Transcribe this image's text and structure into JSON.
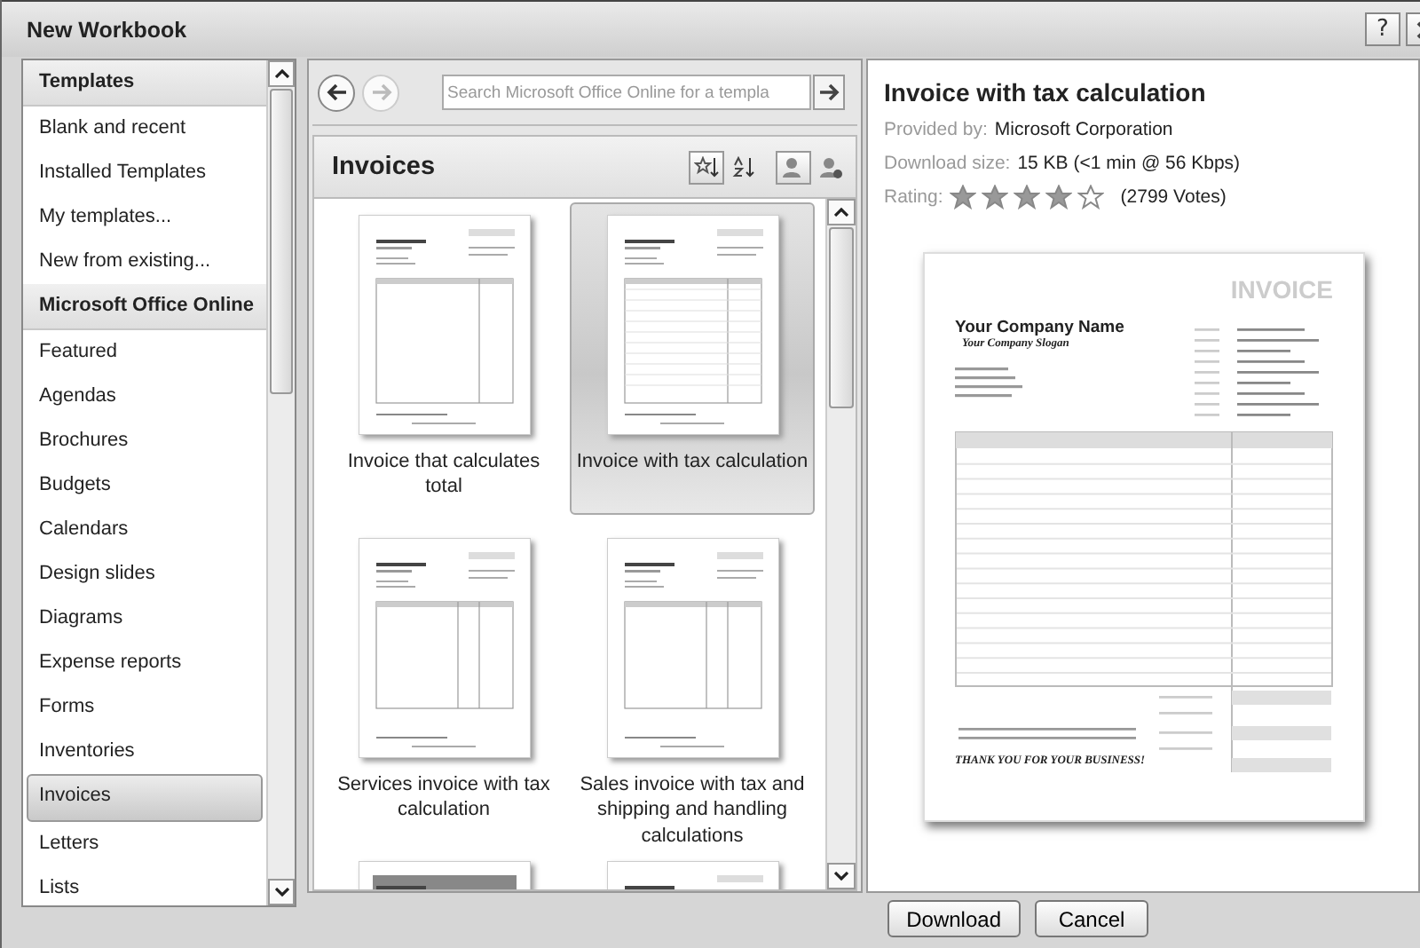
{
  "window": {
    "title": "New Workbook",
    "help": "?"
  },
  "sidebar": {
    "items": [
      {
        "label": "Templates",
        "kind": "header",
        "selected": false
      },
      {
        "label": "Blank and recent",
        "kind": "item",
        "selected": false
      },
      {
        "label": "Installed Templates",
        "kind": "item",
        "selected": false
      },
      {
        "label": "My templates...",
        "kind": "item",
        "selected": false
      },
      {
        "label": "New from existing...",
        "kind": "item",
        "selected": false
      },
      {
        "label": "Microsoft Office Online",
        "kind": "header",
        "selected": false
      },
      {
        "label": "Featured",
        "kind": "item",
        "selected": false
      },
      {
        "label": "Agendas",
        "kind": "item",
        "selected": false
      },
      {
        "label": "Brochures",
        "kind": "item",
        "selected": false
      },
      {
        "label": "Budgets",
        "kind": "item",
        "selected": false
      },
      {
        "label": "Calendars",
        "kind": "item",
        "selected": false
      },
      {
        "label": "Design slides",
        "kind": "item",
        "selected": false
      },
      {
        "label": "Diagrams",
        "kind": "item",
        "selected": false
      },
      {
        "label": "Expense reports",
        "kind": "item",
        "selected": false
      },
      {
        "label": "Forms",
        "kind": "item",
        "selected": false
      },
      {
        "label": "Inventories",
        "kind": "item",
        "selected": false
      },
      {
        "label": "Invoices",
        "kind": "item",
        "selected": true
      },
      {
        "label": "Letters",
        "kind": "item",
        "selected": false
      },
      {
        "label": "Lists",
        "kind": "item",
        "selected": false
      }
    ]
  },
  "navigation": {
    "back_disabled": false,
    "forward_disabled": true,
    "search": {
      "placeholder": "Search Microsoft Office Online for a templa"
    }
  },
  "gallery": {
    "title": "Invoices",
    "sort_buttons": [
      {
        "selected": true
      },
      {
        "selected": false
      }
    ],
    "view_buttons": [
      {
        "selected": true
      },
      {
        "selected": false
      }
    ],
    "templates": [
      {
        "name": "Invoice that calculates total",
        "kind": "simple",
        "selected": false
      },
      {
        "name": "Invoice with tax calculation",
        "kind": "lined",
        "selected": true
      },
      {
        "name": "Services invoice with tax calculation",
        "kind": "columns",
        "selected": false
      },
      {
        "name": "Sales invoice with tax and shipping and handling calculations",
        "kind": "columns",
        "selected": false
      },
      {
        "kind": "banded",
        "selected": false
      },
      {
        "kind": "simple",
        "selected": false
      }
    ]
  },
  "details": {
    "title": "Invoice with tax calculation",
    "provided_by_label": "Provided by:",
    "provided_by": "Microsoft Corporation",
    "size_label": "Download size:",
    "size": "15 KB (<1 min @ 56 Kbps)",
    "rating_label": "Rating:",
    "stars": 4,
    "votes": "(2799 Votes)",
    "preview": {
      "heading": "INVOICE",
      "company": "Your Company Name",
      "slogan": "Your Company Slogan",
      "closing": "THANK YOU FOR YOUR BUSINESS!"
    }
  },
  "buttons": [
    "Download",
    "Cancel"
  ]
}
